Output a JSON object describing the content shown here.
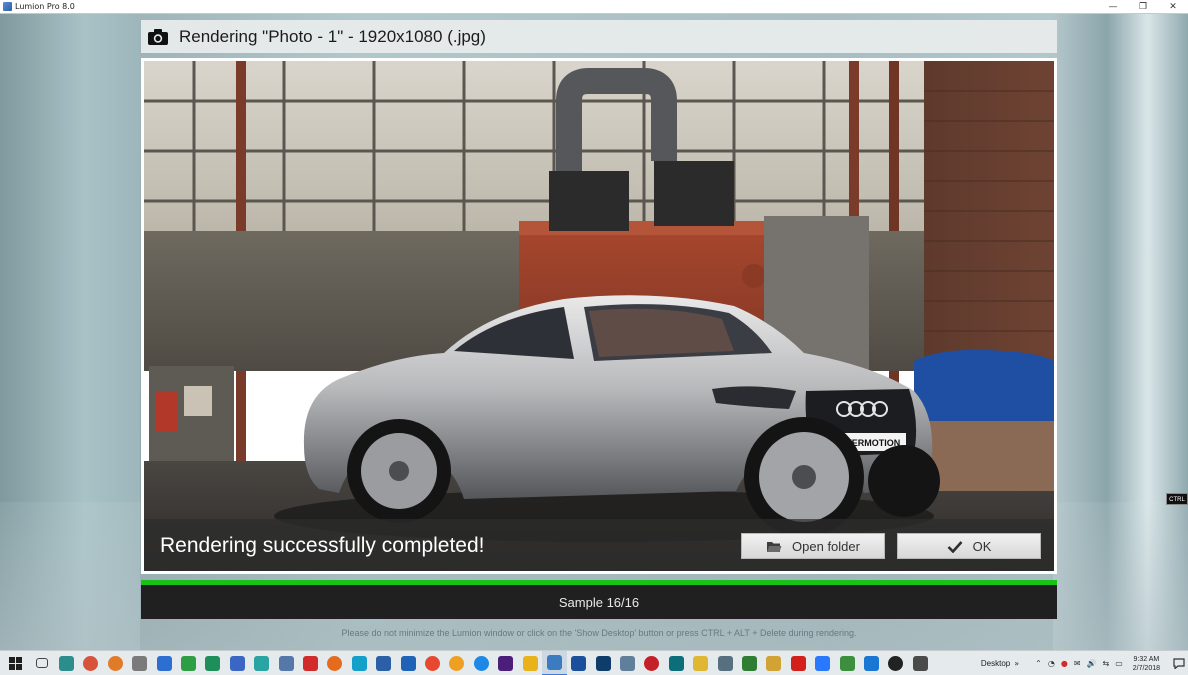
{
  "window": {
    "title": "Lumion Pro 8.0",
    "minimize_glyph": "—",
    "restore_glyph": "❐",
    "close_glyph": "✕"
  },
  "dialog": {
    "title": "Rendering \"Photo - 1\" - 1920x1080 (.jpg)",
    "icon": "camera-icon",
    "preview_badge": "EVERMOTION",
    "status_message": "Rendering successfully completed!",
    "open_folder_label": "Open folder",
    "ok_label": "OK",
    "sample_text": "Sample 16/16",
    "progress": 1.0,
    "hint": "Please do not minimize the Lumion window or click on the 'Show Desktop' button or press CTRL + ALT + Delete during rendering."
  },
  "overlay_tag": "CTRL",
  "taskbar": {
    "icons": [
      {
        "name": "task-view-icon",
        "color": "#444444"
      },
      {
        "name": "app-icon-1",
        "color": "#2c8d8d"
      },
      {
        "name": "app-icon-2",
        "color": "#d9533a"
      },
      {
        "name": "app-icon-3",
        "color": "#e07b2a"
      },
      {
        "name": "app-icon-4",
        "color": "#7a7a7a"
      },
      {
        "name": "app-icon-5",
        "color": "#2d6fd1"
      },
      {
        "name": "app-icon-6",
        "color": "#2e9e45"
      },
      {
        "name": "app-icon-7",
        "color": "#1e8f5a"
      },
      {
        "name": "app-icon-8",
        "color": "#3a66c4"
      },
      {
        "name": "app-icon-9",
        "color": "#2aa3a3"
      },
      {
        "name": "app-icon-10",
        "color": "#5577aa"
      },
      {
        "name": "app-icon-11",
        "color": "#d22b2b"
      },
      {
        "name": "firefox-icon",
        "color": "#e66b1c"
      },
      {
        "name": "app-icon-13",
        "color": "#14a0c8"
      },
      {
        "name": "app-icon-14",
        "color": "#2b5fa8"
      },
      {
        "name": "app-icon-15",
        "color": "#1f63b8"
      },
      {
        "name": "app-icon-16",
        "color": "#e8482f"
      },
      {
        "name": "app-icon-17",
        "color": "#f0a020"
      },
      {
        "name": "app-icon-18",
        "color": "#1e88e5"
      },
      {
        "name": "premiere-icon",
        "color": "#4b1e7a"
      },
      {
        "name": "app-icon-20",
        "color": "#e9b21b"
      },
      {
        "name": "lumion-icon",
        "color": "#3b7bbf"
      },
      {
        "name": "app-icon-22",
        "color": "#1b4f9b"
      },
      {
        "name": "photoshop-icon",
        "color": "#0f3d6b"
      },
      {
        "name": "app-icon-24",
        "color": "#5f7f9a"
      },
      {
        "name": "app-icon-25",
        "color": "#c4202a"
      },
      {
        "name": "app-icon-26",
        "color": "#0c6e7a"
      },
      {
        "name": "app-icon-27",
        "color": "#e0b733"
      },
      {
        "name": "app-icon-28",
        "color": "#567080"
      },
      {
        "name": "app-icon-29",
        "color": "#2e7d32"
      },
      {
        "name": "app-icon-30",
        "color": "#d1a234"
      },
      {
        "name": "acrobat-icon",
        "color": "#d3201b"
      },
      {
        "name": "app-icon-32",
        "color": "#2979ff"
      },
      {
        "name": "app-icon-33",
        "color": "#3c8f3c"
      },
      {
        "name": "app-icon-34",
        "color": "#1976d2"
      },
      {
        "name": "app-icon-35",
        "color": "#222222"
      },
      {
        "name": "app-icon-36",
        "color": "#4a4a4a"
      }
    ],
    "desktop_label": "Desktop",
    "desktop_chevron": "»",
    "tray_symbols": [
      "⌃",
      "◔",
      "●",
      "✉",
      "🔊",
      "⇆",
      "▭"
    ],
    "time": "9:32 AM",
    "date": "2/7/2018"
  }
}
